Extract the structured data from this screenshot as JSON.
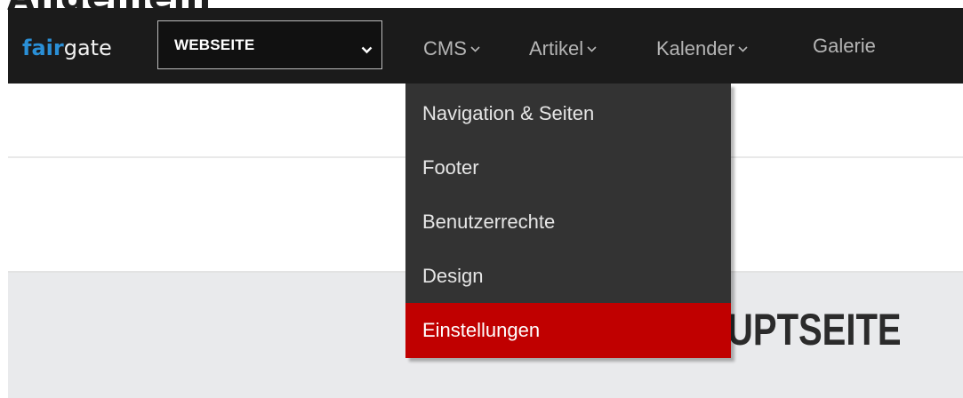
{
  "page": {
    "heading": "Allgemein",
    "background_title": "UPTSEITE"
  },
  "navbar": {
    "logo": {
      "part1": "fair",
      "part2": "gate"
    },
    "site_select": {
      "value": "WEBSEITE"
    },
    "menu": [
      {
        "label": "CMS",
        "has_dropdown": true
      },
      {
        "label": "Artikel",
        "has_dropdown": true
      },
      {
        "label": "Kalender",
        "has_dropdown": true
      },
      {
        "label": "Galerie",
        "has_dropdown": false
      }
    ]
  },
  "dropdown": {
    "items": [
      {
        "label": "Navigation & Seiten"
      },
      {
        "label": "Footer"
      },
      {
        "label": "Benutzerrechte"
      },
      {
        "label": "Design"
      },
      {
        "label": "Einstellungen",
        "active": true
      }
    ]
  },
  "colors": {
    "navbar_bg": "#1b1b1b",
    "logo_accent": "#2a8fd6",
    "dropdown_bg": "#333333",
    "active_item_bg": "#c00000",
    "content_band_bg": "#e9eaec"
  },
  "icons": {
    "select_caret": "chevron-down-icon",
    "menu_caret": "chevron-down-icon"
  }
}
